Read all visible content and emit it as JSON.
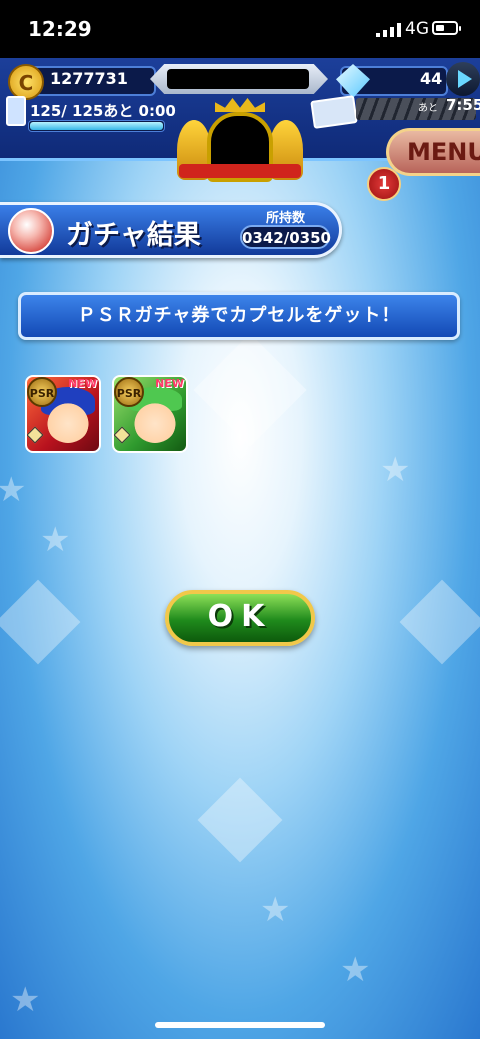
{
  "status_bar": {
    "time": "12:29",
    "network": "4G"
  },
  "header": {
    "coins": "1277731",
    "coin_symbol": "C",
    "gems": "44",
    "stamina": "125/ 125あと  0:00",
    "stamina_fraction": 1.0,
    "ticket_ato": "あと",
    "ticket_time": "7:55"
  },
  "menu": {
    "label": "MENU",
    "badge": "1"
  },
  "title_bar": {
    "title": "ガチャ結果",
    "owned_label": "所持数",
    "owned_count": "0342/0350"
  },
  "message": "ＰＳＲガチャ券でカプセルをゲット！",
  "cards": [
    {
      "rarity": "PSR",
      "badge": "NEW"
    },
    {
      "rarity": "PSR",
      "badge": "NEW"
    }
  ],
  "ok_button": {
    "label": "OK"
  }
}
